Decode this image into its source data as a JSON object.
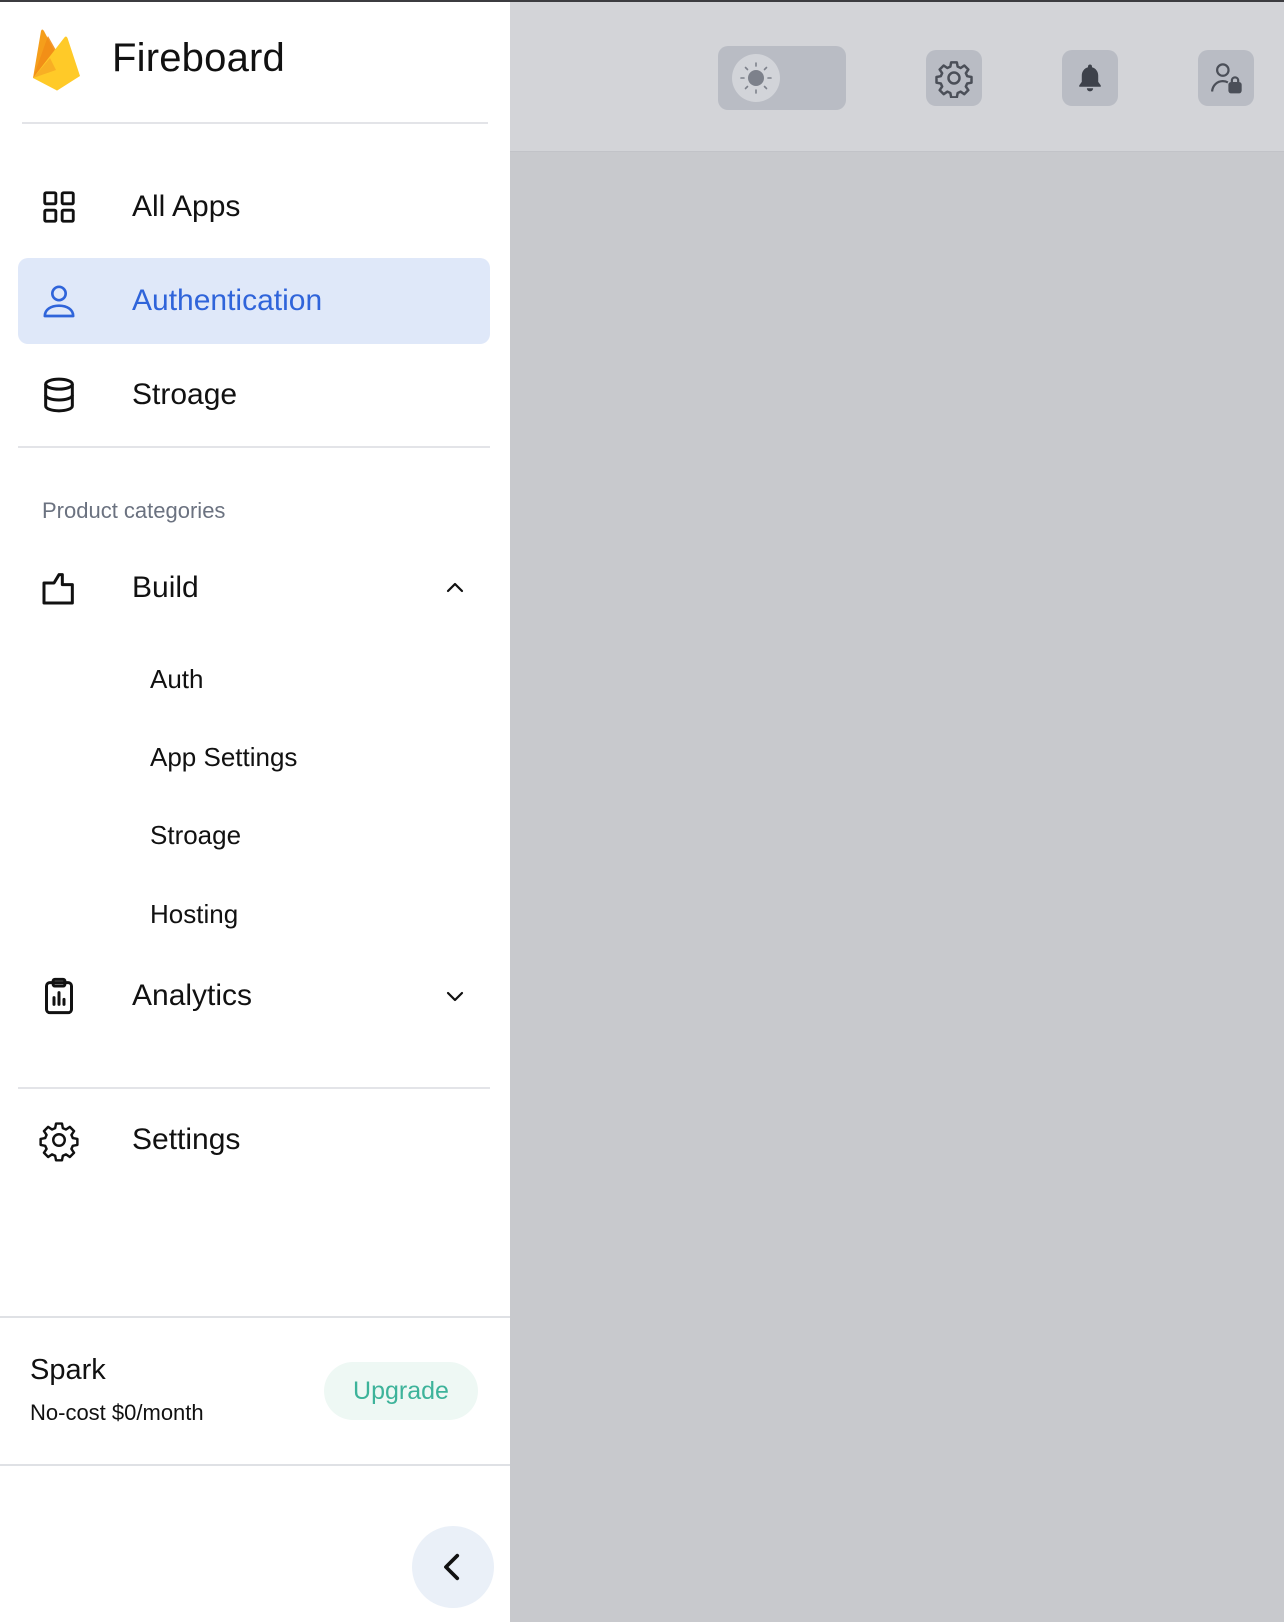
{
  "app": {
    "name": "Fireboard",
    "logo_icon": "firebase-flame-icon"
  },
  "topbar": {
    "theme_toggle_icon": "sun-icon",
    "settings_icon": "gear-icon",
    "notifications_icon": "bell-icon",
    "account_icon": "user-lock-icon"
  },
  "nav": {
    "all_apps": {
      "label": "All Apps",
      "icon": "grid-icon"
    },
    "authentication": {
      "label": "Authentication",
      "icon": "user-icon",
      "active": true
    },
    "storage": {
      "label": "Stroage",
      "icon": "database-icon"
    }
  },
  "categories": {
    "title": "Product categories",
    "build": {
      "label": "Build",
      "icon": "build-icon",
      "expanded": true,
      "items": [
        {
          "label": "Auth"
        },
        {
          "label": "App Settings"
        },
        {
          "label": "Stroage"
        },
        {
          "label": "Hosting"
        }
      ]
    },
    "analytics": {
      "label": "Analytics",
      "icon": "clipboard-chart-icon",
      "expanded": false
    }
  },
  "settings": {
    "label": "Settings",
    "icon": "gear-icon"
  },
  "plan": {
    "name": "Spark",
    "price": "No-cost $0/month",
    "upgrade_label": "Upgrade"
  },
  "collapse": {
    "icon": "chevron-left-icon"
  },
  "colors": {
    "accent": "#2f64da",
    "active_bg": "#dfe8f9",
    "upgrade_text": "#3db39a",
    "upgrade_bg": "#eef8f4",
    "overlay": "#c8c9cd"
  }
}
